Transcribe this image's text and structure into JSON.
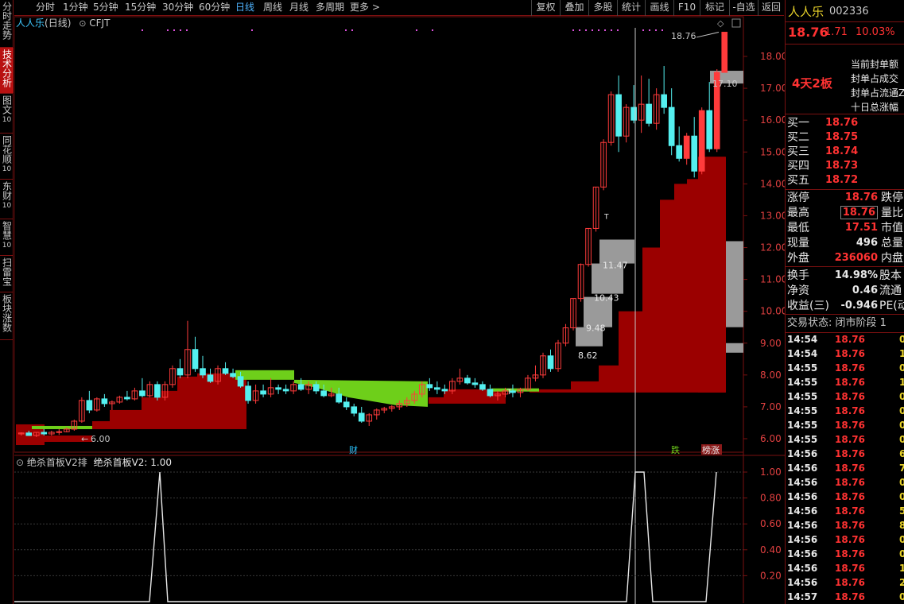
{
  "left_tabs": [
    {
      "label": "分时走势",
      "sub": ""
    },
    {
      "label": "技术分析",
      "sub": ""
    },
    {
      "label": "图文",
      "sub": "10"
    },
    {
      "label": "同花顺",
      "sub": "10"
    },
    {
      "label": "东财",
      "sub": "10"
    },
    {
      "label": "智慧",
      "sub": "10"
    },
    {
      "label": "扫雷宝",
      "sub": ""
    },
    {
      "label": "板块涨数",
      "sub": ""
    }
  ],
  "toolbar": {
    "periods": [
      "分时",
      "1分钟",
      "5分钟",
      "15分钟",
      "30分钟",
      "60分钟",
      "日线",
      "周线",
      "月线",
      "多周期",
      "更多 >"
    ],
    "active_period": "日线",
    "right_buttons": [
      "复权",
      "叠加",
      "多股",
      "统计",
      "画线",
      "F10",
      "标记",
      "-自选",
      "返回"
    ]
  },
  "chart_header": {
    "stock_name": "人人乐",
    "period_label": "(日线)",
    "indicator_label": "CFJT"
  },
  "indicator_header": {
    "name": "绝杀首板V2排",
    "value_text": "绝杀首板V2: 1.00"
  },
  "markers": {
    "cai": "财",
    "die": "跌",
    "bang": "榜涨"
  },
  "right_panel": {
    "stock_name": "人人乐",
    "code": "002336",
    "price": "18.76",
    "change": "1.71",
    "pct": "10.03%",
    "board_tag": "4天2板",
    "info_labels": [
      "当前封单额",
      "封单占成交",
      "封单占流通Z",
      "十日总涨幅"
    ],
    "bids": [
      {
        "label": "买一",
        "price": "18.76"
      },
      {
        "label": "买二",
        "price": "18.75"
      },
      {
        "label": "买三",
        "price": "18.74"
      },
      {
        "label": "买四",
        "price": "18.73"
      },
      {
        "label": "买五",
        "price": "18.72"
      }
    ],
    "stats": [
      {
        "label": "涨停",
        "value": "18.76",
        "right": "跌停"
      },
      {
        "label": "最高",
        "value": "18.76",
        "right": "量比"
      },
      {
        "label": "最低",
        "value": "17.51",
        "right": "市值"
      },
      {
        "label": "现量",
        "value": "496",
        "right": "总量"
      },
      {
        "label": "外盘",
        "value": "236060",
        "right": "内盘"
      }
    ],
    "stats2": [
      {
        "label": "换手",
        "value": "14.98%",
        "right": "股本"
      },
      {
        "label": "净资",
        "value": "0.46",
        "right": "流通"
      },
      {
        "label": "收益(三)",
        "value": "-0.946",
        "right": "PE(动"
      }
    ],
    "status": "交易状态: 闭市阶段 1",
    "ticks": [
      {
        "time": "14:54",
        "price": "18.76",
        "vol": "0"
      },
      {
        "time": "14:54",
        "price": "18.76",
        "vol": "1"
      },
      {
        "time": "14:55",
        "price": "18.76",
        "vol": "0"
      },
      {
        "time": "14:55",
        "price": "18.76",
        "vol": "1"
      },
      {
        "time": "14:55",
        "price": "18.76",
        "vol": "0"
      },
      {
        "time": "14:55",
        "price": "18.76",
        "vol": "0"
      },
      {
        "time": "14:55",
        "price": "18.76",
        "vol": "0"
      },
      {
        "time": "14:55",
        "price": "18.76",
        "vol": "0"
      },
      {
        "time": "14:56",
        "price": "18.76",
        "vol": "6"
      },
      {
        "time": "14:56",
        "price": "18.76",
        "vol": "7"
      },
      {
        "time": "14:56",
        "price": "18.76",
        "vol": "0"
      },
      {
        "time": "14:56",
        "price": "18.76",
        "vol": "0"
      },
      {
        "time": "14:56",
        "price": "18.76",
        "vol": "5"
      },
      {
        "time": "14:56",
        "price": "18.76",
        "vol": "8"
      },
      {
        "time": "14:56",
        "price": "18.76",
        "vol": "0"
      },
      {
        "time": "14:56",
        "price": "18.76",
        "vol": "0"
      },
      {
        "time": "14:56",
        "price": "18.76",
        "vol": "1"
      },
      {
        "time": "14:56",
        "price": "18.76",
        "vol": "2"
      },
      {
        "time": "14:57",
        "price": "18.76",
        "vol": "0"
      }
    ]
  },
  "chart_data": {
    "type": "candlestick",
    "y_ticks": [
      "18.00",
      "17.00",
      "16.00",
      "15.00",
      "14.00",
      "13.00",
      "12.00",
      "11.00",
      "10.00",
      "9.00",
      "8.00",
      "7.00",
      "6.00"
    ],
    "price_labels": [
      "18.76",
      "17.10",
      "11.47",
      "10.43",
      "9.48",
      "8.62",
      "6.00"
    ],
    "candles": [
      [
        6.15,
        6.2,
        6.1,
        6.18
      ],
      [
        6.18,
        6.25,
        6.12,
        6.1
      ],
      [
        6.1,
        6.2,
        6.05,
        6.2
      ],
      [
        6.2,
        6.3,
        6.1,
        6.15
      ],
      [
        6.15,
        6.25,
        6.1,
        6.2
      ],
      [
        6.2,
        6.3,
        6.12,
        6.22
      ],
      [
        6.22,
        6.35,
        6.2,
        6.3
      ],
      [
        6.3,
        6.6,
        6.25,
        6.55
      ],
      [
        6.55,
        7.3,
        6.5,
        7.2
      ],
      [
        7.2,
        7.5,
        6.8,
        6.9
      ],
      [
        6.9,
        7.3,
        6.85,
        7.25
      ],
      [
        7.25,
        7.4,
        7.0,
        7.1
      ],
      [
        7.1,
        7.2,
        6.9,
        7.15
      ],
      [
        7.15,
        7.35,
        7.1,
        7.3
      ],
      [
        7.3,
        7.5,
        7.2,
        7.25
      ],
      [
        7.25,
        7.6,
        7.2,
        7.5
      ],
      [
        7.5,
        7.9,
        7.3,
        7.35
      ],
      [
        7.35,
        7.8,
        7.3,
        7.7
      ],
      [
        7.7,
        7.8,
        7.2,
        7.3
      ],
      [
        7.3,
        7.8,
        7.2,
        7.7
      ],
      [
        7.7,
        8.3,
        7.6,
        8.2
      ],
      [
        8.2,
        8.5,
        7.9,
        8.0
      ],
      [
        8.0,
        9.7,
        7.9,
        8.8
      ],
      [
        8.8,
        9.2,
        8.1,
        8.2
      ],
      [
        8.2,
        8.6,
        7.9,
        8.0
      ],
      [
        8.0,
        8.2,
        7.75,
        7.8
      ],
      [
        7.8,
        8.3,
        7.7,
        8.2
      ],
      [
        8.2,
        8.4,
        8.0,
        8.05
      ],
      [
        8.05,
        8.2,
        7.9,
        7.95
      ],
      [
        7.95,
        8.1,
        7.6,
        7.65
      ],
      [
        7.65,
        7.8,
        7.1,
        7.2
      ],
      [
        7.2,
        7.7,
        7.1,
        7.5
      ],
      [
        7.5,
        7.7,
        7.3,
        7.4
      ],
      [
        7.4,
        7.9,
        7.3,
        7.6
      ],
      [
        7.6,
        7.7,
        7.4,
        7.55
      ],
      [
        7.55,
        7.7,
        7.4,
        7.5
      ],
      [
        7.5,
        7.8,
        7.4,
        7.7
      ],
      [
        7.7,
        7.9,
        7.5,
        7.55
      ],
      [
        7.55,
        7.8,
        7.4,
        7.7
      ],
      [
        7.7,
        7.8,
        7.4,
        7.5
      ],
      [
        7.5,
        7.7,
        7.3,
        7.35
      ],
      [
        7.35,
        7.6,
        7.3,
        7.4
      ],
      [
        7.4,
        7.6,
        7.1,
        7.15
      ],
      [
        7.15,
        7.3,
        6.9,
        7.0
      ],
      [
        7.0,
        7.1,
        6.7,
        6.8
      ],
      [
        6.8,
        7.0,
        6.5,
        6.55
      ],
      [
        6.55,
        6.8,
        6.4,
        6.75
      ],
      [
        6.75,
        6.95,
        6.6,
        6.9
      ],
      [
        6.9,
        7.0,
        6.8,
        6.95
      ],
      [
        6.95,
        7.05,
        6.85,
        7.0
      ],
      [
        7.0,
        7.2,
        6.9,
        7.1
      ],
      [
        7.1,
        7.3,
        7.0,
        7.2
      ],
      [
        7.2,
        7.5,
        7.1,
        7.4
      ],
      [
        7.4,
        7.8,
        7.3,
        7.7
      ],
      [
        7.7,
        7.9,
        7.5,
        7.6
      ],
      [
        7.6,
        7.8,
        7.4,
        7.55
      ],
      [
        7.55,
        7.7,
        7.4,
        7.5
      ],
      [
        7.5,
        7.9,
        7.4,
        7.8
      ],
      [
        7.8,
        8.2,
        7.7,
        7.9
      ],
      [
        7.9,
        8.0,
        7.7,
        7.75
      ],
      [
        7.75,
        7.9,
        7.6,
        7.7
      ],
      [
        7.7,
        7.8,
        7.5,
        7.55
      ],
      [
        7.55,
        7.7,
        7.3,
        7.35
      ],
      [
        7.35,
        7.5,
        7.2,
        7.4
      ],
      [
        7.4,
        7.6,
        7.3,
        7.5
      ],
      [
        7.5,
        7.7,
        7.3,
        7.45
      ],
      [
        7.45,
        7.6,
        7.3,
        7.55
      ],
      [
        7.55,
        8.0,
        7.5,
        7.9
      ],
      [
        7.9,
        8.3,
        7.8,
        8.0
      ],
      [
        8.0,
        8.7,
        7.9,
        8.6
      ],
      [
        8.6,
        8.8,
        8.1,
        8.2
      ],
      [
        8.2,
        9.1,
        8.1,
        9.0
      ],
      [
        9.0,
        9.6,
        8.9,
        9.48
      ],
      [
        9.48,
        10.4,
        9.4,
        10.4
      ],
      [
        10.4,
        11.5,
        10.3,
        11.47
      ],
      [
        11.47,
        12.6,
        11.4,
        12.6
      ],
      [
        12.6,
        13.9,
        12.5,
        13.9
      ],
      [
        13.9,
        15.4,
        13.8,
        15.3
      ],
      [
        15.3,
        16.9,
        15.2,
        16.8
      ],
      [
        16.8,
        17.4,
        15.0,
        15.5
      ],
      [
        15.5,
        16.5,
        15.3,
        16.4
      ],
      [
        16.4,
        17.1,
        15.9,
        16.0
      ],
      [
        16.0,
        17.4,
        15.6,
        16.5
      ],
      [
        16.5,
        17.3,
        15.8,
        15.9
      ],
      [
        15.9,
        17.0,
        15.7,
        16.8
      ],
      [
        16.8,
        17.7,
        16.2,
        16.4
      ],
      [
        16.4,
        17.0,
        14.9,
        15.2
      ],
      [
        15.2,
        15.8,
        14.7,
        14.8
      ],
      [
        14.8,
        15.6,
        14.6,
        15.5
      ],
      [
        15.5,
        16.1,
        14.2,
        14.4
      ],
      [
        14.4,
        16.4,
        14.3,
        16.3
      ],
      [
        16.3,
        17.2,
        15.0,
        15.1
      ],
      [
        15.1,
        17.6,
        15.0,
        17.5
      ],
      [
        17.5,
        18.76,
        17.51,
        18.76
      ]
    ],
    "indicator": {
      "name": "绝杀首板V2",
      "y_ticks": [
        "1.00",
        "0.80",
        "0.60",
        "0.40",
        "0.20"
      ],
      "ylim": [
        0,
        1
      ]
    }
  }
}
